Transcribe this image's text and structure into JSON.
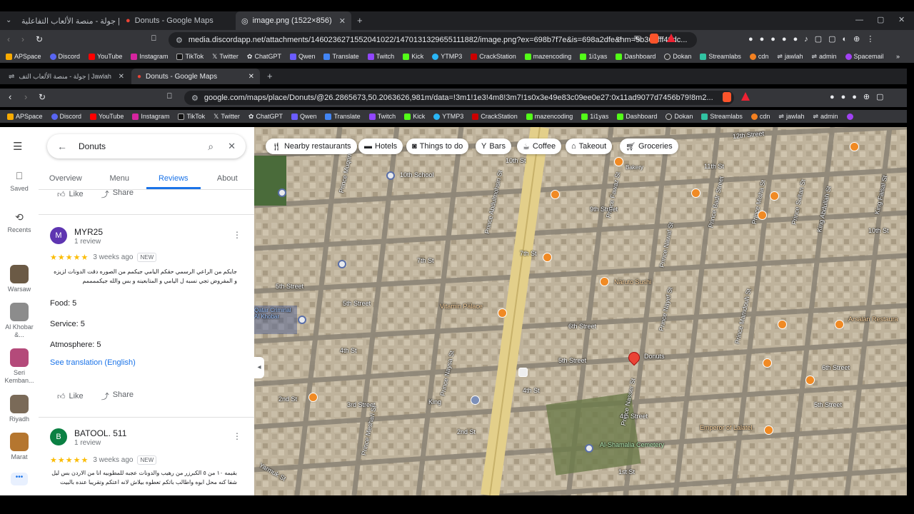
{
  "outer_tabs": [
    {
      "label": "Jawlah | جولة - منصة الألعاب التفاعلية"
    },
    {
      "label": "Donuts - Google Maps"
    },
    {
      "label": "image.png (1522×856)"
    }
  ],
  "outer_url": "media.discordapp.net/attachments/1460236271552041022/1470131329655111882/image.png?ex=698b7f7e&is=698a2dfe&hm=9b362fff40dc...",
  "bookmarks": [
    "APSpace",
    "Discord",
    "YouTube",
    "Instagram",
    "TikTok",
    "Twitter",
    "ChatGPT",
    "Qwen",
    "Translate",
    "Twitch",
    "Kick",
    "YTMP3",
    "CrackStation",
    "mazencoding",
    "1i1yas",
    "Dashboard",
    "Dokan",
    "Streamlabs",
    "cdn",
    "jawlah",
    "admin",
    "Spacemail"
  ],
  "inner_tabs": [
    {
      "label": "Jawlah | جولة - منصة الألعاب التف"
    },
    {
      "label": "Donuts - Google Maps"
    }
  ],
  "inner_url": "google.com/maps/place/Donuts/@26.2865673,50.2063626,981m/data=!3m1!1e3!4m8!3m7!1s0x3e49e83c09ee0e27:0x11ad9077d7456b79!8m2...",
  "inner_bookmarks": [
    "APSpace",
    "Discord",
    "YouTube",
    "Instagram",
    "TikTok",
    "Twitter",
    "ChatGPT",
    "Qwen",
    "Translate",
    "Twitch",
    "Kick",
    "YTMP3",
    "CrackStation",
    "mazencoding",
    "1i1yas",
    "Dashboard",
    "Dokan",
    "Streamlabs",
    "cdn",
    "jawlah",
    "admin"
  ],
  "rail": {
    "saved": "Saved",
    "recents": "Recents",
    "places": [
      {
        "label": "Warsaw"
      },
      {
        "label": "Al Khobar &..."
      },
      {
        "label": "Seri Kemban..."
      },
      {
        "label": "Riyadh"
      },
      {
        "label": "Marat"
      }
    ]
  },
  "search": {
    "value": "Donuts"
  },
  "place_tabs": [
    "Overview",
    "Menu",
    "Reviews",
    "About"
  ],
  "reviews": [
    {
      "initial": "M",
      "avatar_color": "#5e35b1",
      "name": "MYR25",
      "meta": "1 review",
      "time": "3 weeks ago",
      "badge": "NEW",
      "text": "جايكم من الراعي الرسمي حقكم اليامي جيكمم من الصوره دقت الدونات لزيزه و المفروض تجي نسبه ل اليامي و المتابعينه و بس والله جيكممممم",
      "food": "Food: 5",
      "service": "Service: 5",
      "atmosphere": "Atmosphere: 5",
      "translate": "See translation (English)",
      "like": "Like",
      "share": "Share"
    },
    {
      "initial": "B",
      "avatar_color": "#0b8043",
      "name": "BATOOL. 511",
      "meta": "1 review",
      "time": "3 weeks ago",
      "badge": "NEW",
      "text": "بقيمه ١٠ من ٥ الكبرزر من رهيب والدونات عجبه للمطوبيه انا من الاردن بس ليل شفا كنه محل ابوه واطالب باتكم تعطوه بيلاش لانه اعتكم وتقريبا عنده بالبيت"
    }
  ],
  "top_like": "Like",
  "top_share": "Share",
  "chips": [
    "Nearby restaurants",
    "Hotels",
    "Things to do",
    "Bars",
    "Coffee",
    "Takeout",
    "Groceries"
  ],
  "map_labels": {
    "school": "10th School",
    "vitamin": "Vitamin Palace",
    "naruto": "Naruto Sushi",
    "donuts": "Donuts",
    "arsalan": "Arsalan Restaura",
    "emperor": "Emperor of Lalatel",
    "cemetery": "Al-Shamalia Cemetery",
    "qatar": "Qatar Criminal Al Khobar",
    "bakery": "Bakery",
    "king": "King"
  },
  "streets": {
    "s10": "10th St",
    "s12": "12th Street",
    "s11": "11th St",
    "s7a": "7th St",
    "s7b": "7th St",
    "s9": "9th Street",
    "s5a": "5th Street",
    "s5b": "5th Street",
    "s5c": "5th Street",
    "s5d": "5th Street",
    "s6a": "6th Street",
    "s6b": "6th Street",
    "s4a": "4th St",
    "s4b": "4th Street",
    "s4c": "4th St",
    "s3": "3rd Street",
    "s2": "2nd St",
    "s2b": "2nd St",
    "s1": "1st St",
    "s10b": "10th St",
    "pmuqrin": "Prince Muqrin",
    "pabdul": "Prince Abdulmohsin St",
    "pfawaz": "Prince Fawaz St",
    "pnawaf": "Prince Nawaf St",
    "pbadr": "Prince Badr Street",
    "pmisha": "Prince Misha St",
    "psultan": "Prince Sultan St",
    "kabdullah": "King Abdullah St",
    "kfaisal": "King Faisal St",
    "pnayef": "Prince Nayef St",
    "pmamdouh": "Prince Mamdouh St",
    "pmeshari": "Prince Meshari St",
    "yarmuk": "Yarmuk St",
    "pnasser": "Prince Nasser St",
    "pnaysa": "Prince Naysa St"
  }
}
